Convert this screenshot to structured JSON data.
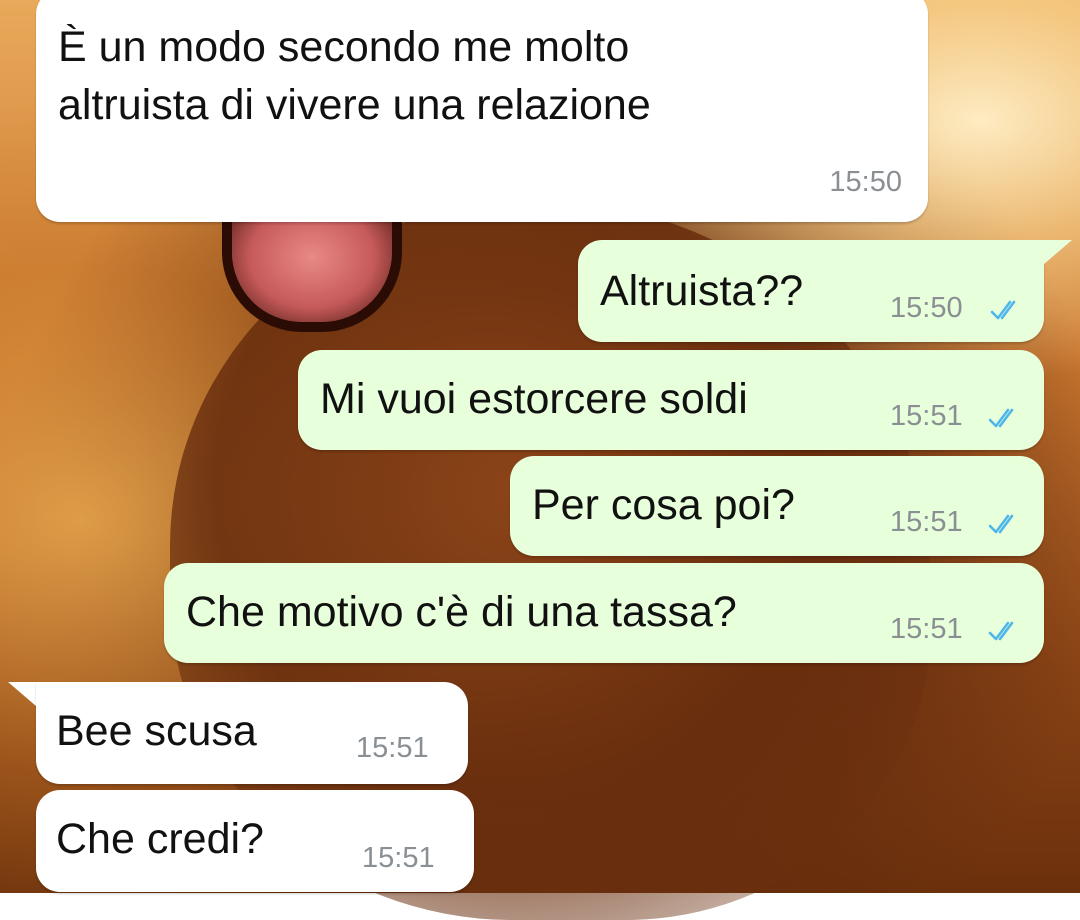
{
  "chat": {
    "background_icon": "lion-wallpaper",
    "colors": {
      "incoming_bubble": "#ffffff",
      "outgoing_bubble": "#e7ffdb",
      "read_ticks": "#4fb6ec",
      "timestamp": "#8a8f93"
    },
    "messages": [
      {
        "direction": "incoming",
        "text_lines": [
          "È un modo secondo me molto",
          "altruista di vivere una relazione"
        ],
        "time": "15:50"
      },
      {
        "direction": "outgoing",
        "text": "Altruista??",
        "time": "15:50",
        "status": "read"
      },
      {
        "direction": "outgoing",
        "text": "Mi vuoi estorcere soldi",
        "time": "15:51",
        "status": "read"
      },
      {
        "direction": "outgoing",
        "text": "Per cosa poi?",
        "time": "15:51",
        "status": "read"
      },
      {
        "direction": "outgoing",
        "text": "Che motivo c'è di una tassa?",
        "time": "15:51",
        "status": "read"
      },
      {
        "direction": "incoming",
        "text": "Bee scusa",
        "time": "15:51"
      },
      {
        "direction": "incoming",
        "text": "Che credi?",
        "time": "15:51"
      }
    ]
  }
}
